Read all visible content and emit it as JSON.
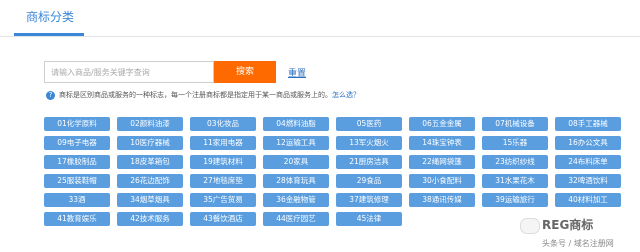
{
  "header": {
    "tab_title": "商标分类"
  },
  "search": {
    "placeholder": "请输入商品/服务关键字查询",
    "button_label": "搜索",
    "reset_label": "重置"
  },
  "info": {
    "text": "商标是区别商品或服务的一种标志，每一个注册商标都是指定用于某一商品或服务上的。",
    "link": "怎么选？"
  },
  "categories": [
    "01化学原料",
    "02颜料油漆",
    "03化妆品",
    "04燃料油脂",
    "05医药",
    "06五金金属",
    "07机械设备",
    "08手工器械",
    "09电子电器",
    "10医疗器械",
    "11家用电器",
    "12运输工具",
    "13军火烟火",
    "14珠宝钟表",
    "15乐器",
    "16办公文具",
    "17橡胶制品",
    "18皮革箱包",
    "19建筑材料",
    "20家具",
    "21厨房洁具",
    "22绳网袋篷",
    "23纺织纱线",
    "24布料床单",
    "25服装鞋帽",
    "26花边配饰",
    "27地毯席垫",
    "28体育玩具",
    "29食品",
    "30小食配料",
    "31水果花木",
    "32啤酒饮料",
    "33酒",
    "34烟草烟具",
    "35广告贸易",
    "36金融物管",
    "37建筑修理",
    "38通讯传媒",
    "39运输旅行",
    "40材料加工",
    "41教育娱乐",
    "42技术服务",
    "43餐饮酒店",
    "44医疗园艺",
    "45法律"
  ],
  "watermark": {
    "brand": "REG商标",
    "sub": "头条号 / 域名注册网"
  },
  "colors": {
    "accent": "#3a86d8",
    "button": "#ff6a00",
    "category_bg": "#5a9ee0"
  }
}
